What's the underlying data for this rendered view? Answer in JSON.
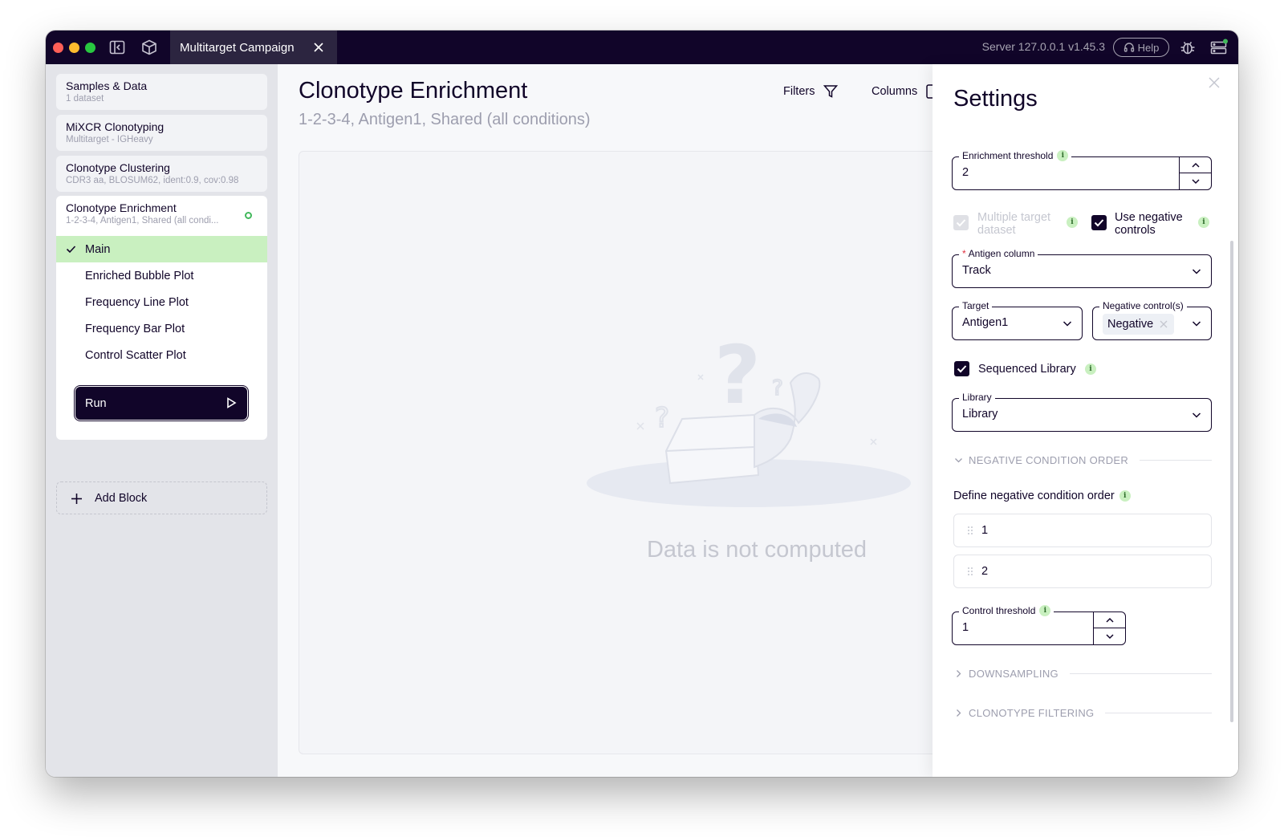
{
  "titlebar": {
    "tab_label": "Multitarget Campaign",
    "server": "Server 127.0.0.1 v1.45.3",
    "help_label": "Help"
  },
  "sidebar": {
    "blocks": [
      {
        "title": "Samples & Data",
        "subtitle": "1 dataset"
      },
      {
        "title": "MiXCR Clonotyping",
        "subtitle": "Multitarget - IGHeavy"
      },
      {
        "title": "Clonotype Clustering",
        "subtitle": "CDR3 aa, BLOSUM62, ident:0.9, cov:0.98"
      }
    ],
    "active_block": {
      "title": "Clonotype Enrichment",
      "subtitle": "1-2-3-4, Antigen1, Shared (all condi...",
      "subitems": [
        "Main",
        "Enriched Bubble Plot",
        "Frequency Line Plot",
        "Frequency Bar Plot",
        "Control Scatter Plot"
      ],
      "run_label": "Run"
    },
    "add_block_label": "Add Block"
  },
  "main": {
    "title": "Clonotype Enrichment",
    "subtitle": "1-2-3-4, Antigen1, Shared (all conditions)",
    "filters_label": "Filters",
    "columns_label": "Columns",
    "empty_text": "Data is not computed"
  },
  "settings": {
    "title": "Settings",
    "enrichment_threshold": {
      "label": "Enrichment threshold",
      "value": "2"
    },
    "multiple_target": {
      "label": "Multiple target dataset",
      "line1": "Multiple target",
      "line2": "dataset",
      "checked": true,
      "disabled": true
    },
    "use_negative": {
      "line1": "Use negative",
      "line2": "controls",
      "checked": true
    },
    "antigen_column": {
      "label": "Antigen column",
      "required": "*",
      "value": "Track"
    },
    "target": {
      "label": "Target",
      "value": "Antigen1"
    },
    "negative_controls": {
      "label": "Negative control(s)",
      "chip": "Negative"
    },
    "sequenced_library": {
      "label": "Sequenced Library",
      "checked": true
    },
    "library": {
      "label": "Library",
      "value": "Library"
    },
    "negative_condition_order": {
      "header": "NEGATIVE CONDITION ORDER",
      "define_label": "Define negative condition order",
      "items": [
        "1",
        "2"
      ]
    },
    "control_threshold": {
      "label": "Control threshold",
      "value": "1"
    },
    "downsampling_header": "DOWNSAMPLING",
    "clonotype_filtering_header": "CLONOTYPE FILTERING"
  },
  "colors": {
    "titlebar_bg": "#110529",
    "sidebar_bg": "#e3e4e9",
    "selected_item_bg": "#c9f0c0",
    "primary": "#110529",
    "muted_text": "#9d9eae"
  }
}
